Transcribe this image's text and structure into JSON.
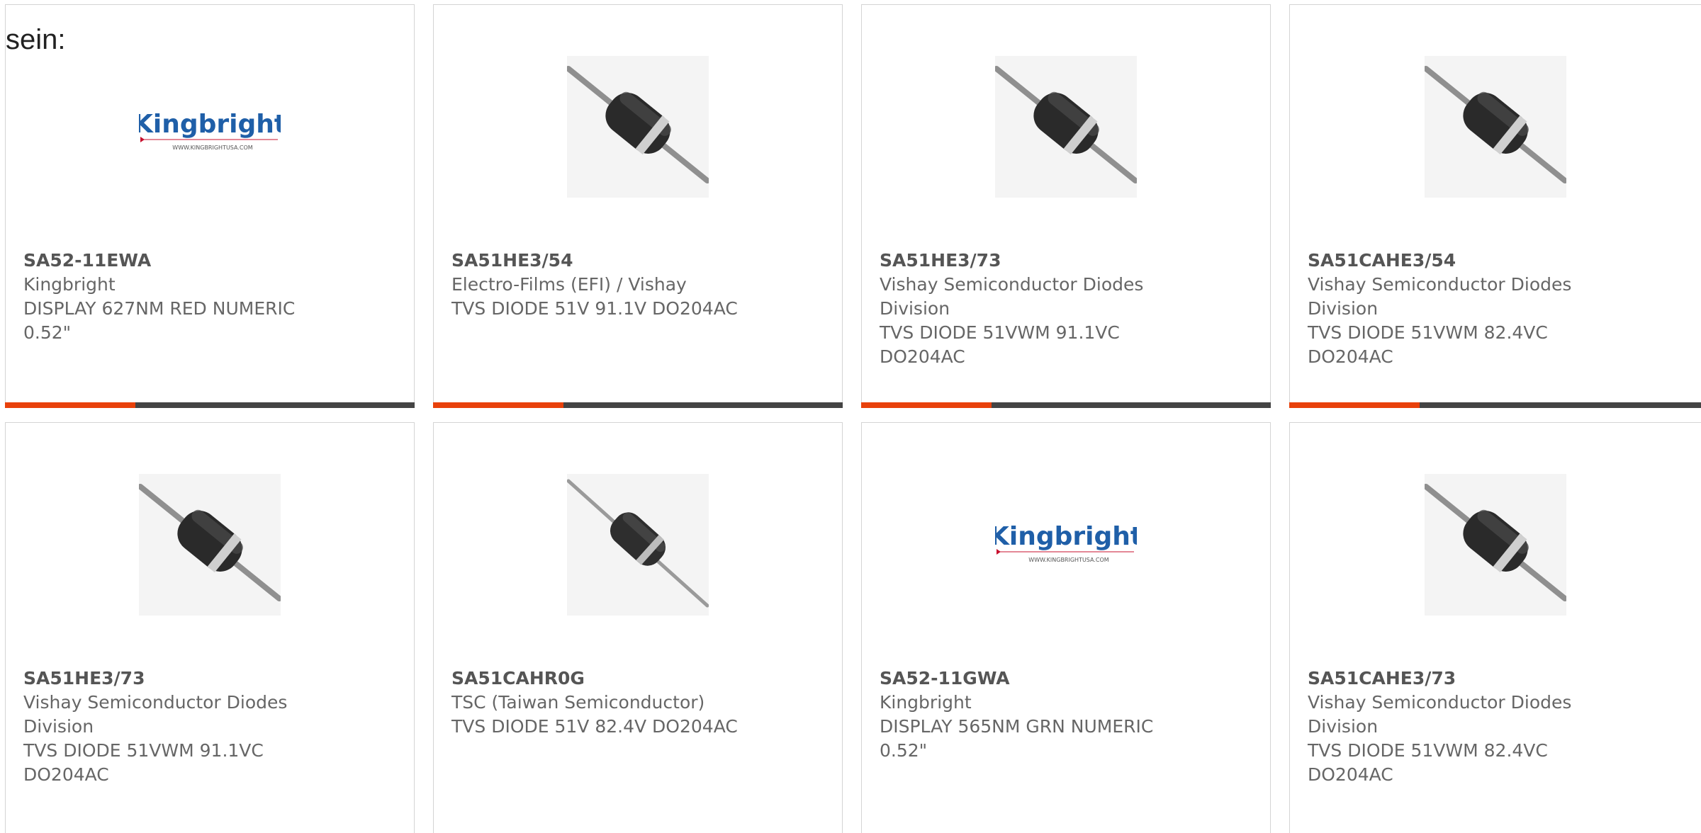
{
  "header": {
    "text": "sein:"
  },
  "colors": {
    "accent": "#e8410b",
    "bar": "#444444",
    "brand_blue": "#1f5fa8"
  },
  "cards": [
    {
      "image": "kingbright-logo",
      "logo_text": "Kingbright",
      "logo_url": "WWW.KINGBRIGHTUSA.COM",
      "mpn": "SA52-11EWA",
      "manufacturer": "Kingbright",
      "description": "DISPLAY 627NM RED NUMERIC 0.52\""
    },
    {
      "image": "axial-diode",
      "mpn": "SA51HE3/54",
      "manufacturer": "Electro-Films (EFI) / Vishay",
      "description": "TVS DIODE 51V 91.1V DO204AC"
    },
    {
      "image": "axial-diode",
      "mpn": "SA51HE3/73",
      "manufacturer": "Vishay Semiconductor Diodes Division",
      "description": "TVS DIODE 51VWM 91.1VC DO204AC"
    },
    {
      "image": "axial-diode",
      "mpn": "SA51CAHE3/54",
      "manufacturer": "Vishay Semiconductor Diodes Division",
      "description": "TVS DIODE 51VWM 82.4VC DO204AC"
    },
    {
      "image": "axial-diode",
      "mpn": "SA51HE3/73",
      "manufacturer": "Vishay Semiconductor Diodes Division",
      "description": "TVS DIODE 51VWM 91.1VC DO204AC"
    },
    {
      "image": "axial-diode-thin",
      "mpn": "SA51CAHR0G",
      "manufacturer": "TSC (Taiwan Semiconductor)",
      "description": "TVS DIODE 51V 82.4V DO204AC"
    },
    {
      "image": "kingbright-logo",
      "logo_text": "Kingbright",
      "logo_url": "WWW.KINGBRIGHTUSA.COM",
      "mpn": "SA52-11GWA",
      "manufacturer": "Kingbright",
      "description": "DISPLAY 565NM GRN NUMERIC 0.52\""
    },
    {
      "image": "axial-diode",
      "mpn": "SA51CAHE3/73",
      "manufacturer": "Vishay Semiconductor Diodes Division",
      "description": "TVS DIODE 51VWM 82.4VC DO204AC"
    }
  ]
}
